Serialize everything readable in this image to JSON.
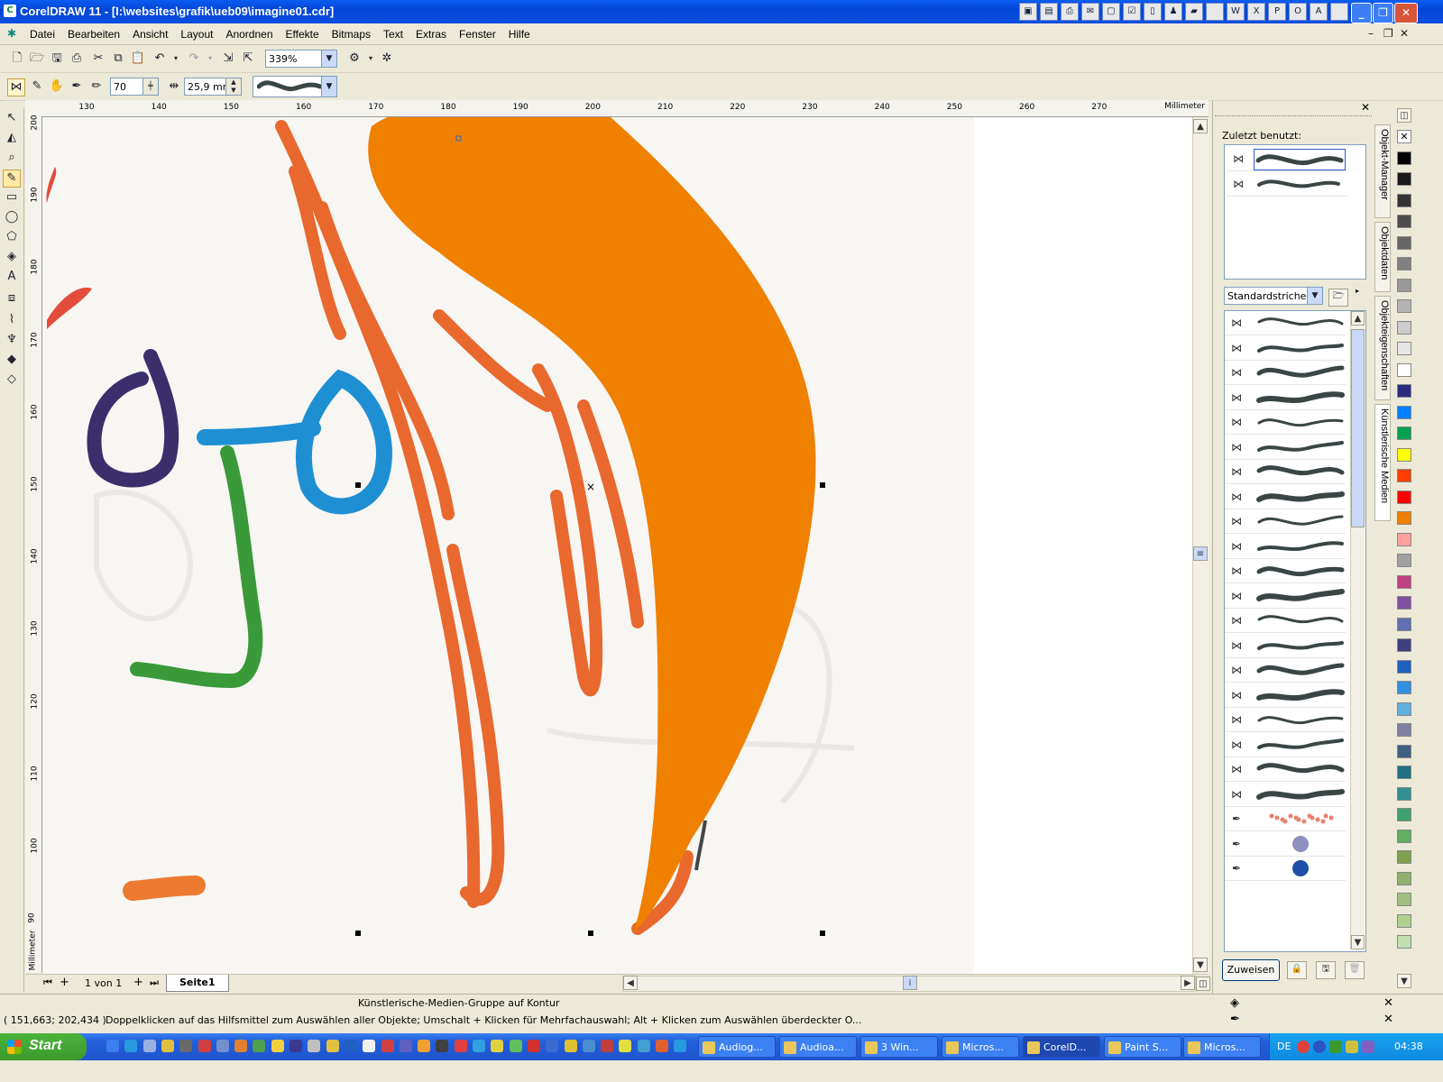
{
  "window": {
    "title": "CorelDRAW 11 - [I:\\websites\\grafik\\ueb09\\imagine01.cdr]"
  },
  "menu": {
    "items": [
      "Datei",
      "Bearbeiten",
      "Ansicht",
      "Layout",
      "Anordnen",
      "Effekte",
      "Bitmaps",
      "Text",
      "Extras",
      "Fenster",
      "Hilfe"
    ]
  },
  "toolbar": {
    "zoom": "339%",
    "artistic_width": "70",
    "stroke_width": "25,9 mm"
  },
  "ruler": {
    "unit": "Millimeter",
    "h_ticks": [
      "130",
      "140",
      "150",
      "160",
      "170",
      "180",
      "190",
      "200",
      "210",
      "220",
      "230",
      "240",
      "250",
      "260",
      "270"
    ],
    "v_ticks": [
      "200",
      "190",
      "180",
      "170",
      "160",
      "150",
      "140",
      "130",
      "120",
      "110",
      "100",
      "90"
    ]
  },
  "page_nav": {
    "count": "1 von 1",
    "tab": "Seite1"
  },
  "docker": {
    "recent_label": "Zuletzt benutzt:",
    "category": "Standardstriche",
    "apply_button": "Zuweisen",
    "tabs": [
      "Objekt-Manager",
      "Objektdaten",
      "Objekteigenschaften",
      "Künstlerische Medien"
    ]
  },
  "status": {
    "top_message": "Künstlerische-Medien-Gruppe auf Kontur",
    "coords": "( 151,663; 202,434 )",
    "hint": "Doppelklicken auf das Hilfsmittel zum Auswählen aller Objekte; Umschalt + Klicken für Mehrfachauswahl; Alt + Klicken zum Auswählen überdeckter O..."
  },
  "taskbar": {
    "start": "Start",
    "tasks": [
      "Audiog...",
      "Audioa...",
      "3 Win...",
      "Micros...",
      "CorelD...",
      "Paint S...",
      "Micros..."
    ],
    "lang": "DE",
    "clock": "04:38"
  },
  "colors": {
    "accent_orange": "#f08000",
    "sketch_orange": "#e8682e",
    "sketch_blue": "#1f8fd4",
    "sketch_purple": "#3a2f6b",
    "sketch_green": "#3a9a3a",
    "titlebar_blue": "#0a5cf0"
  }
}
